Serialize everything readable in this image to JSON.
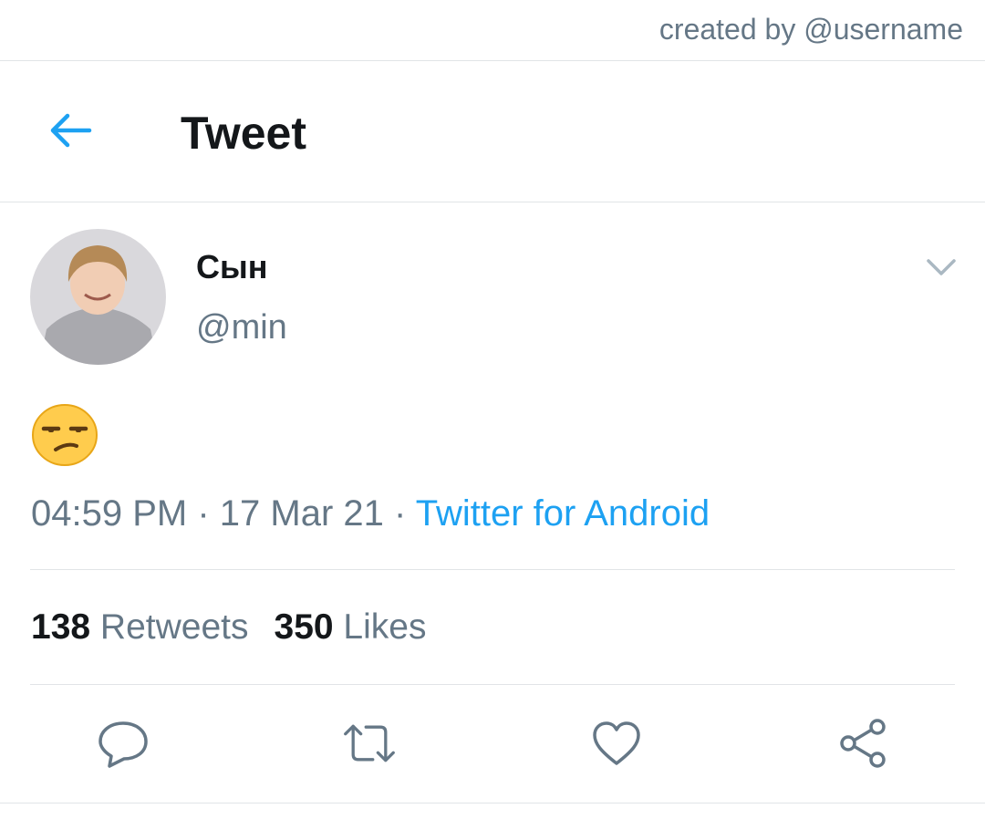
{
  "credit": "created by @username",
  "header": {
    "title": "Tweet"
  },
  "tweet": {
    "name": "Сын",
    "handle": "@min",
    "time": "04:59 PM",
    "date": "17 Mar 21",
    "sep": "·",
    "source": "Twitter for Android",
    "retweets_count": "138",
    "retweets_label": "Retweets",
    "likes_count": "350",
    "likes_label": "Likes"
  },
  "colors": {
    "accent": "#1da1f2",
    "secondary_text": "#657786",
    "divider": "#e1e4e7"
  }
}
